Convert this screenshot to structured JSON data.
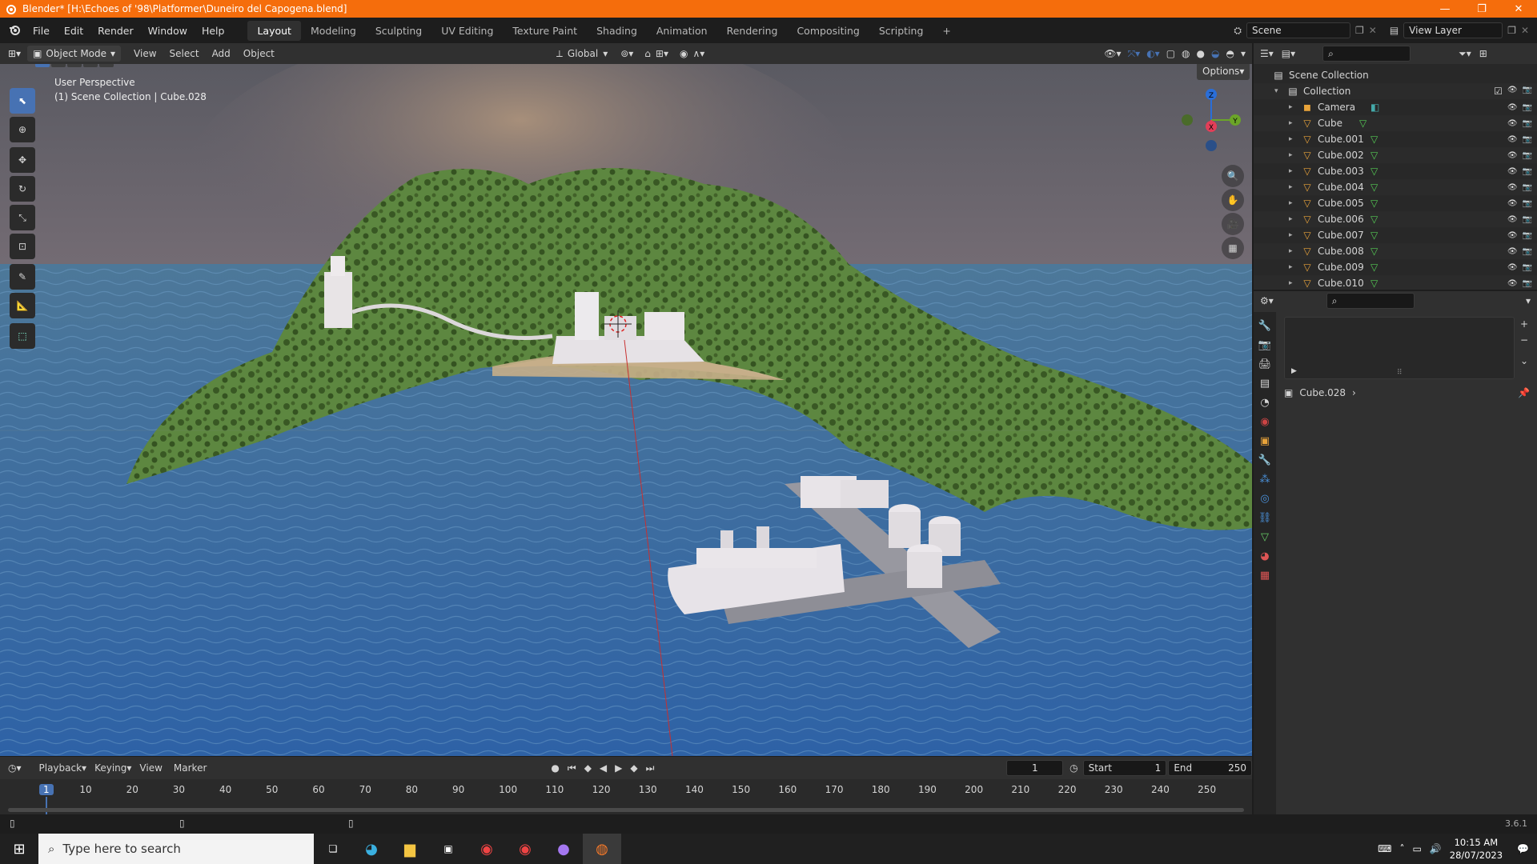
{
  "window": {
    "title": "Blender* [H:\\Echoes of '98\\Platformer\\Duneiro del Capogena.blend]",
    "controls": [
      "—",
      "❐",
      "✕"
    ]
  },
  "menu": [
    "File",
    "Edit",
    "Render",
    "Window",
    "Help"
  ],
  "workspaces": [
    "Layout",
    "Modeling",
    "Sculpting",
    "UV Editing",
    "Texture Paint",
    "Shading",
    "Animation",
    "Rendering",
    "Compositing",
    "Scripting",
    "+"
  ],
  "scene": {
    "name": "Scene",
    "view_layer": "View Layer"
  },
  "viewport_header": {
    "mode": "Object Mode",
    "menus": [
      "View",
      "Select",
      "Add",
      "Object"
    ],
    "orientation": "Global",
    "options": "Options"
  },
  "viewport": {
    "perspective": "User Perspective",
    "context": "(1) Scene Collection | Cube.028"
  },
  "gizmo": {
    "z": "Z",
    "y": "Y",
    "x": "X"
  },
  "outliner": {
    "root": "Scene Collection",
    "collection": "Collection",
    "items": [
      "Camera",
      "Cube",
      "Cube.001",
      "Cube.002",
      "Cube.003",
      "Cube.004",
      "Cube.005",
      "Cube.006",
      "Cube.007",
      "Cube.008",
      "Cube.009",
      "Cube.010"
    ]
  },
  "properties": {
    "object": "Cube.028"
  },
  "timeline": {
    "menus": [
      "Playback",
      "Keying",
      "View",
      "Marker"
    ],
    "current_frame": "1",
    "start_label": "Start",
    "start": "1",
    "end_label": "End",
    "end": "250",
    "ticks": [
      "1",
      "10",
      "20",
      "30",
      "40",
      "50",
      "60",
      "70",
      "80",
      "90",
      "100",
      "110",
      "120",
      "130",
      "140",
      "150",
      "160",
      "170",
      "180",
      "190",
      "200",
      "210",
      "220",
      "230",
      "240",
      "250"
    ]
  },
  "version": "3.6.1",
  "taskbar": {
    "search_placeholder": "Type here to search",
    "time": "10:15 AM",
    "date": "28/07/2023"
  },
  "colors": {
    "accent": "#4772b3",
    "title": "#f56d0c",
    "mesh_icon": "#e8a33a"
  }
}
